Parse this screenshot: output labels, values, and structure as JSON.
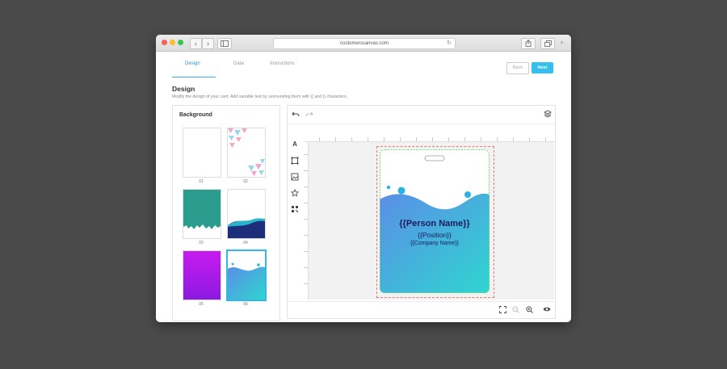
{
  "browser": {
    "url": "customerscanvas.com",
    "back_glyph": "‹",
    "forward_glyph": "›",
    "reload_glyph": "↻"
  },
  "tabs": [
    {
      "label": "Design",
      "active": true
    },
    {
      "label": "Data",
      "active": false
    },
    {
      "label": "Instructions",
      "active": false
    }
  ],
  "buttons": {
    "back": "Back",
    "next": "Next"
  },
  "section": {
    "title": "Design",
    "description": "Modify the design of your card. Add variable text by surrounding them with {{ and }} characters."
  },
  "background_panel": {
    "title": "Background",
    "items": [
      {
        "label": "01",
        "style": "blank"
      },
      {
        "label": "02",
        "style": "triangles"
      },
      {
        "label": "03",
        "style": "teal-city"
      },
      {
        "label": "04",
        "style": "navy-wave"
      },
      {
        "label": "05",
        "style": "magenta-gradient"
      },
      {
        "label": "06",
        "style": "blue-wave",
        "selected": true
      }
    ]
  },
  "editor": {
    "undo_icon": "undo-icon",
    "redo_icon": "redo-icon",
    "layers_icon": "layers-icon",
    "tools": [
      "text-tool-icon",
      "shape-tool-icon",
      "image-tool-icon",
      "star-tool-icon",
      "qr-code-tool-icon"
    ],
    "card": {
      "name": "{{Person Name}}",
      "position": "{{Position}}",
      "company": "{{Company Name}}"
    },
    "bottom_tools": [
      "fit-screen-icon",
      "zoom-out-icon",
      "zoom-in-icon",
      "preview-icon"
    ]
  },
  "colors": {
    "accent": "#33bff0",
    "gradient_start": "#5b8ee6",
    "gradient_end": "#2ed6d0",
    "card_text": "#1b1b5a"
  }
}
